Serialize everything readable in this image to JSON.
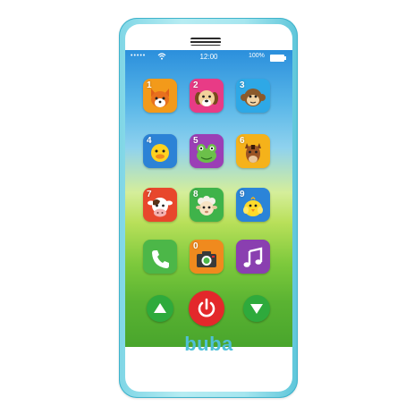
{
  "status_bar": {
    "signal": "•••••",
    "time": "12:00",
    "battery": "100%"
  },
  "apps": [
    {
      "number": "1",
      "icon": "fox-icon",
      "color": "#f39a1a"
    },
    {
      "number": "2",
      "icon": "dog-icon",
      "color": "#e83b86"
    },
    {
      "number": "3",
      "icon": "monkey-icon",
      "color": "#2ea8e6"
    },
    {
      "number": "4",
      "icon": "duck-icon",
      "color": "#2c82d6"
    },
    {
      "number": "5",
      "icon": "frog-icon",
      "color": "#9b3fb6"
    },
    {
      "number": "6",
      "icon": "horse-icon",
      "color": "#f5b21a"
    },
    {
      "number": "7",
      "icon": "cow-icon",
      "color": "#e8472c"
    },
    {
      "number": "8",
      "icon": "sheep-icon",
      "color": "#3fb34a"
    },
    {
      "number": "9",
      "icon": "chick-icon",
      "color": "#2b84d8"
    },
    {
      "number": "",
      "icon": "phone-icon",
      "color": "#4cb748"
    },
    {
      "number": "0",
      "icon": "camera-icon",
      "color": "#f08a1e"
    },
    {
      "number": "",
      "icon": "music-icon",
      "color": "#8a3fb0"
    }
  ],
  "controls": {
    "up": {
      "icon": "triangle-up-icon",
      "color": "#2eaa3c"
    },
    "power": {
      "icon": "power-icon",
      "color": "#e3282b"
    },
    "down": {
      "icon": "triangle-down-icon",
      "color": "#2eaa3c"
    }
  },
  "brand": "buba"
}
